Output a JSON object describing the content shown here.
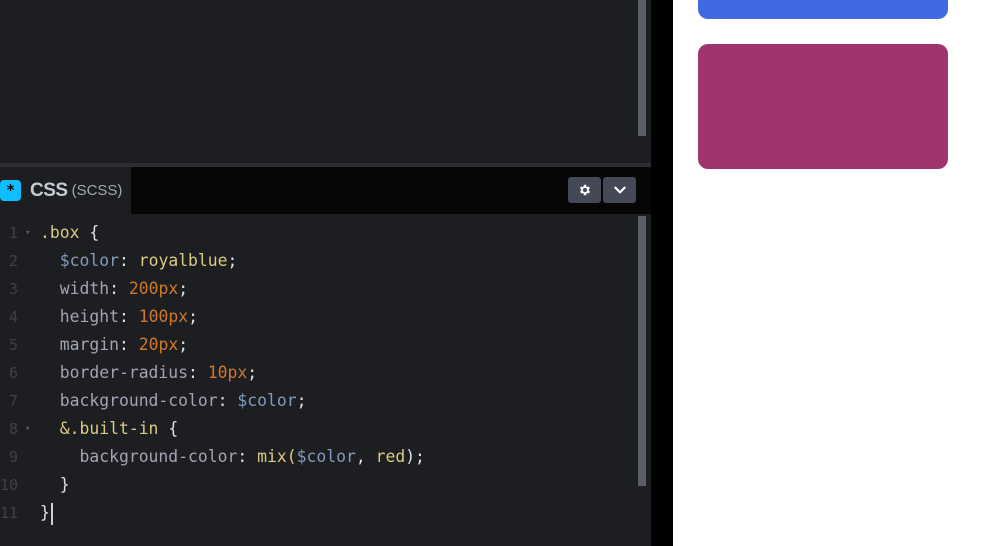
{
  "css_panel": {
    "badge": "*",
    "title": "CSS",
    "subtitle": "(SCSS)"
  },
  "header_buttons": {
    "settings_icon": "gear-icon",
    "collapse_icon": "chevron-down-icon"
  },
  "code_lines": [
    {
      "n": "1",
      "fold": "▾",
      "tokens": [
        ".box",
        " ",
        "{"
      ]
    },
    {
      "n": "2",
      "fold": "",
      "tokens": [
        "  ",
        "$color",
        ": ",
        "royalblue",
        ";"
      ]
    },
    {
      "n": "3",
      "fold": "",
      "tokens": [
        "  ",
        "width",
        ": ",
        "200px",
        ";"
      ]
    },
    {
      "n": "4",
      "fold": "",
      "tokens": [
        "  ",
        "height",
        ": ",
        "100px",
        ";"
      ]
    },
    {
      "n": "5",
      "fold": "",
      "tokens": [
        "  ",
        "margin",
        ": ",
        "20px",
        ";"
      ]
    },
    {
      "n": "6",
      "fold": "",
      "tokens": [
        "  ",
        "border-radius",
        ": ",
        "10px",
        ";"
      ]
    },
    {
      "n": "7",
      "fold": "",
      "tokens": [
        "  ",
        "background-color",
        ": ",
        "$color",
        ";"
      ]
    },
    {
      "n": "8",
      "fold": "▾",
      "tokens": [
        "  ",
        "&.built-in",
        " ",
        "{"
      ]
    },
    {
      "n": "9",
      "fold": "",
      "tokens": [
        "    ",
        "background-color",
        ": ",
        "mix(",
        "$color",
        ", ",
        "red",
        ");"
      ]
    },
    {
      "n": "10",
      "fold": "",
      "tokens": [
        "  ",
        "}"
      ]
    },
    {
      "n": "11",
      "fold": "",
      "tokens": [
        "}"
      ]
    }
  ],
  "preview": {
    "box_color": "#4169e1",
    "mixed_color": "#a0346f"
  },
  "colors": {
    "editor_bg": "#1d1e22",
    "badge": "#0ebeff"
  }
}
